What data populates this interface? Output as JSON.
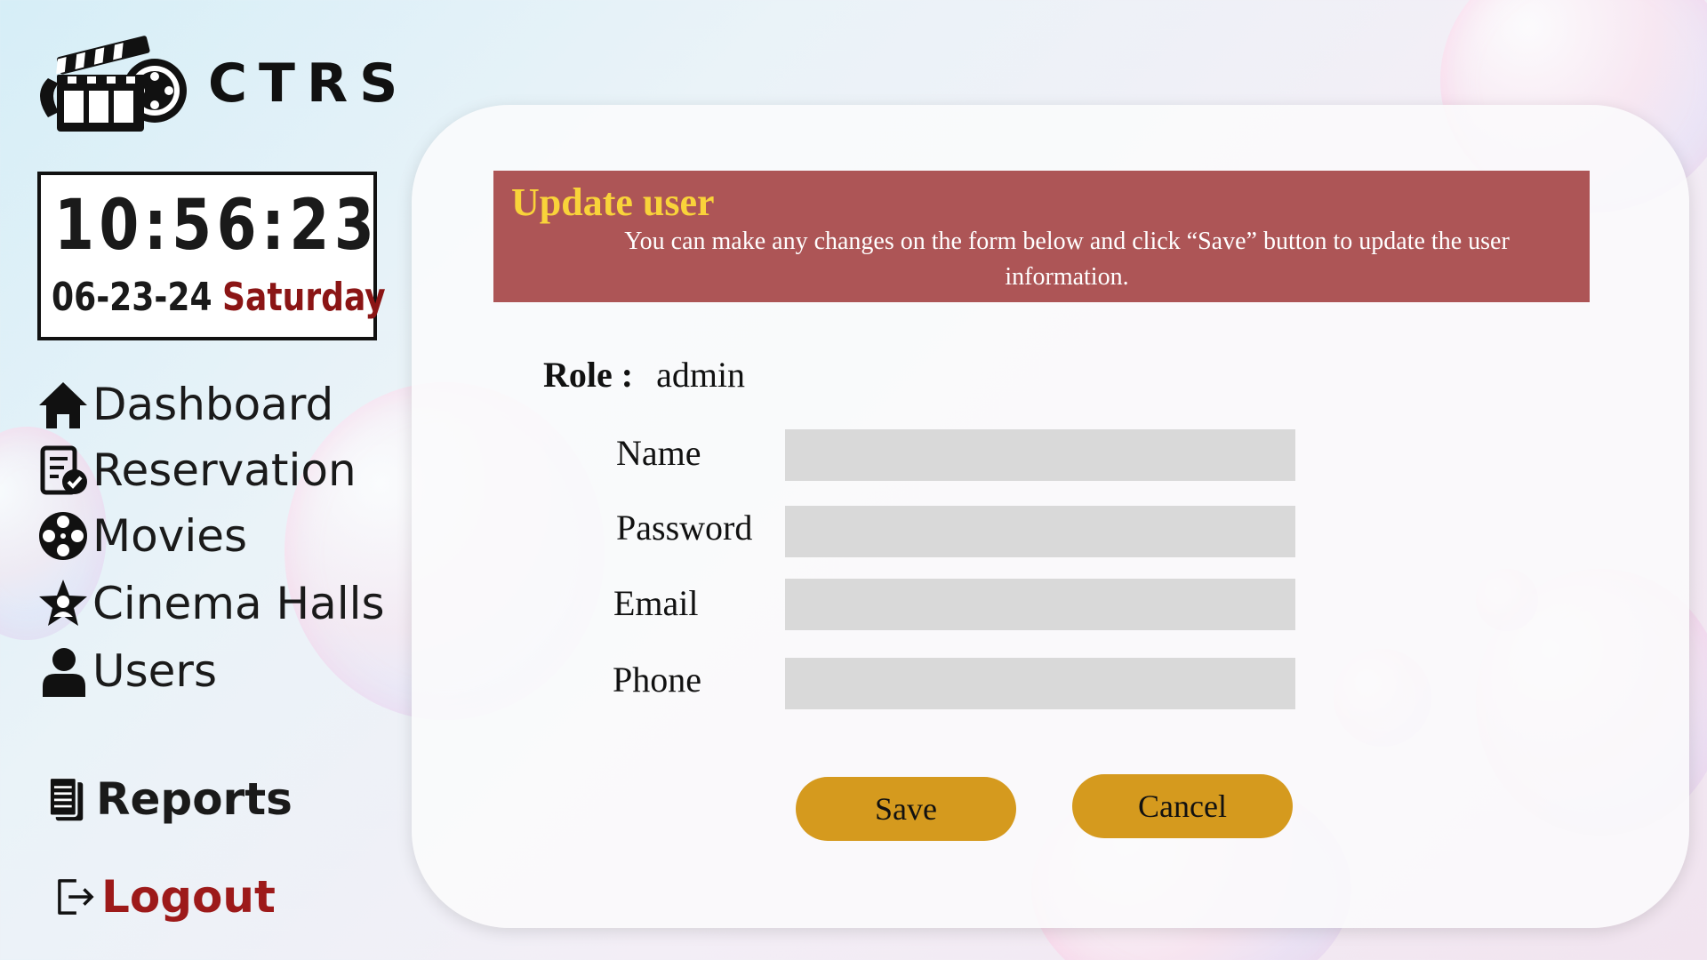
{
  "app": {
    "brand": "CTRS",
    "logo_icon": "clapperboard-film-reel-icon"
  },
  "clock": {
    "time": "10:56:23",
    "date": "06-23-24",
    "day": "Saturday"
  },
  "sidebar": {
    "items": [
      {
        "label": "Dashboard",
        "icon": "home-icon"
      },
      {
        "label": "Reservation",
        "icon": "checklist-icon"
      },
      {
        "label": "Movies",
        "icon": "film-reel-icon"
      },
      {
        "label": "Cinema Halls",
        "icon": "star-user-icon"
      },
      {
        "label": "Users",
        "icon": "user-icon"
      }
    ],
    "reports": {
      "label": "Reports",
      "icon": "document-icon"
    },
    "logout": {
      "label": "Logout",
      "icon": "logout-icon"
    }
  },
  "banner": {
    "title": "Update user",
    "description": "You can make any changes on the form below and click “Save” button to update the user information."
  },
  "form": {
    "role_label": "Role :",
    "role_value": "admin",
    "fields": [
      {
        "label": "Name",
        "value": ""
      },
      {
        "label": "Password",
        "value": ""
      },
      {
        "label": "Email",
        "value": ""
      },
      {
        "label": "Phone",
        "value": ""
      }
    ],
    "save_label": "Save",
    "cancel_label": "Cancel"
  },
  "colors": {
    "banner_bg": "#ad5556",
    "banner_title": "#f9d33a",
    "button_bg": "#d59a1e",
    "logout_text": "#9d1a1a",
    "day_text": "#8b1515",
    "input_bg": "#d9d9d9"
  }
}
